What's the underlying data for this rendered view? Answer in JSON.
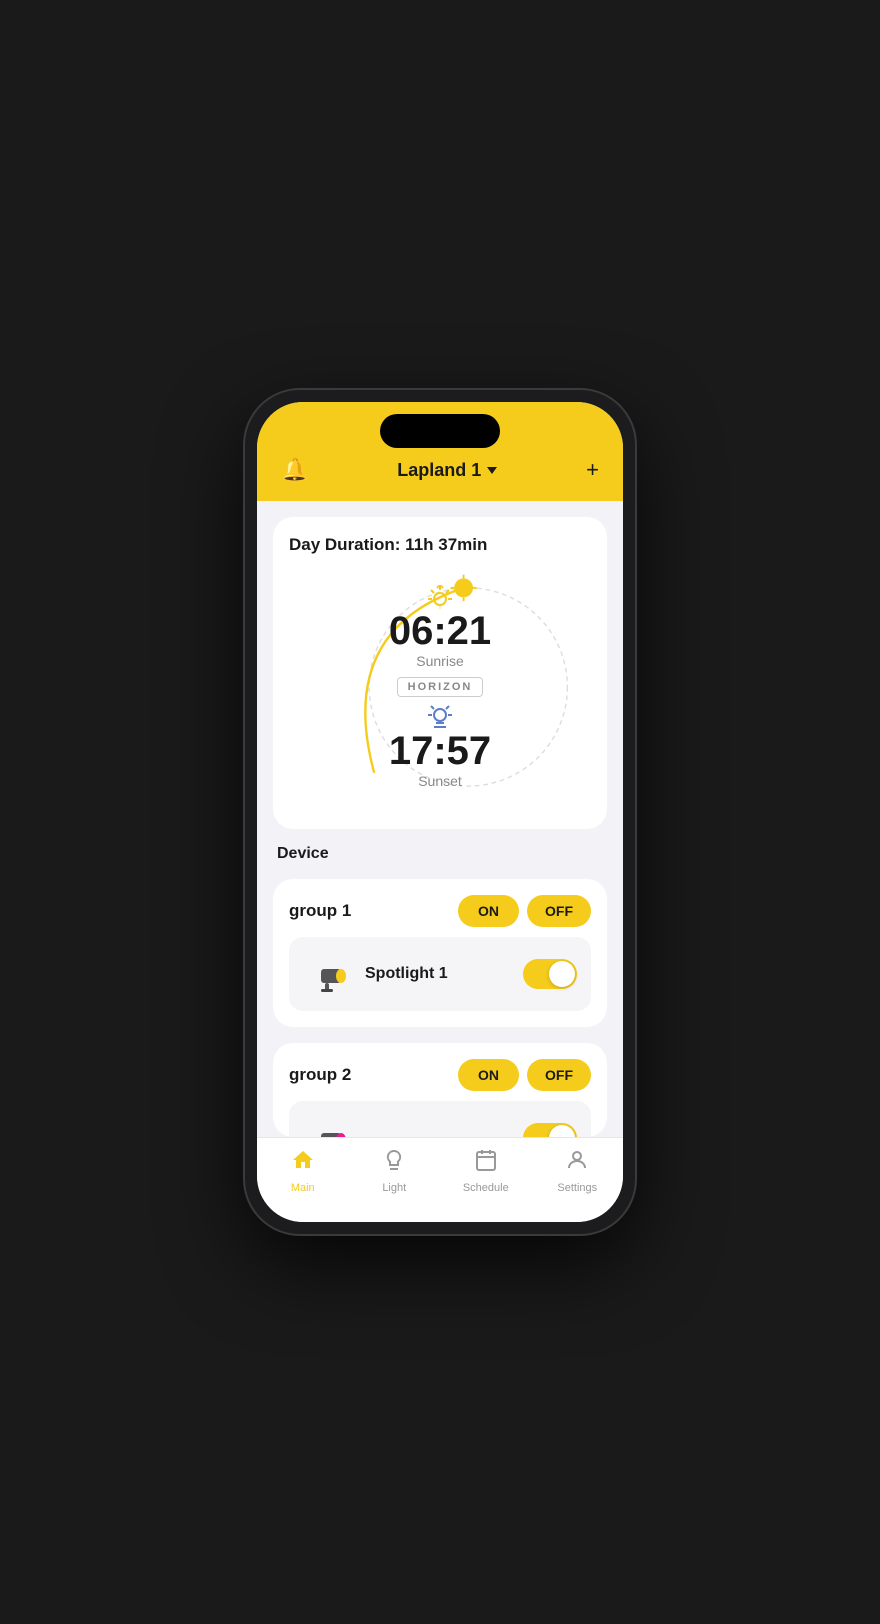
{
  "app": {
    "title": "Lapland 1",
    "bell_icon": "🔔",
    "plus_icon": "+",
    "colors": {
      "yellow": "#f5cc1b",
      "bg": "#f2f2f7",
      "white": "#ffffff",
      "dark": "#1a1a1a",
      "gray": "#888888"
    }
  },
  "sun_card": {
    "title": "Day Duration: 11h 37min",
    "sunrise_time": "06:21",
    "sunrise_label": "Sunrise",
    "horizon_label": "HORIZON",
    "sunset_time": "17:57",
    "sunset_label": "Sunset"
  },
  "device_section": {
    "label": "Device"
  },
  "groups": [
    {
      "id": "group1",
      "name": "group 1",
      "on_label": "ON",
      "off_label": "OFF",
      "devices": [
        {
          "id": "spotlight1",
          "name": "Spotlight 1",
          "toggle_on": true
        }
      ]
    },
    {
      "id": "group2",
      "name": "group 2",
      "on_label": "ON",
      "off_label": "OFF",
      "devices": [
        {
          "id": "device2",
          "name": "...",
          "toggle_on": true
        }
      ]
    }
  ],
  "bottom_nav": {
    "items": [
      {
        "id": "main",
        "label": "Main",
        "icon": "house",
        "active": true
      },
      {
        "id": "light",
        "label": "Light",
        "icon": "bulb",
        "active": false
      },
      {
        "id": "schedule",
        "label": "Schedule",
        "icon": "calendar",
        "active": false
      },
      {
        "id": "settings",
        "label": "Settings",
        "icon": "person",
        "active": false
      }
    ]
  }
}
